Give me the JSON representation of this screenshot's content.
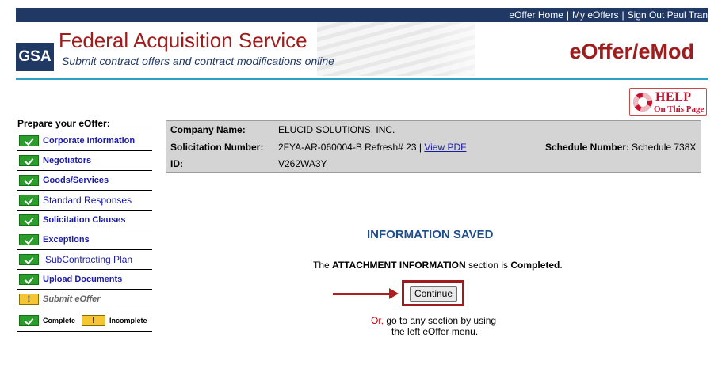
{
  "topbar": {
    "home": "eOffer Home",
    "my": "My eOffers",
    "signout": "Sign Out Paul Tran",
    "separator": "|"
  },
  "header": {
    "logo": "GSA",
    "title": "Federal Acquisition Service",
    "subtitle": "Submit contract offers and contract modifications online",
    "app_title": "eOffer/eMod"
  },
  "help": {
    "icon": "lifebuoy-icon",
    "line1": "HELP",
    "line2": "On This Page"
  },
  "sidebar": {
    "title": "Prepare your eOffer:",
    "items": [
      {
        "label": "Corporate Information",
        "status": "complete"
      },
      {
        "label": "Negotiators",
        "status": "complete"
      },
      {
        "label": "Goods/Services",
        "status": "complete"
      },
      {
        "label": "Standard Responses",
        "status": "complete"
      },
      {
        "label": "Solicitation Clauses",
        "status": "complete"
      },
      {
        "label": "Exceptions",
        "status": "complete"
      },
      {
        "label": "SubContracting Plan",
        "status": "complete"
      },
      {
        "label": "Upload Documents",
        "status": "complete"
      },
      {
        "label": "Submit eOffer",
        "status": "incomplete"
      }
    ],
    "legend": {
      "complete": "Complete",
      "incomplete": "Incomplete",
      "warn_glyph": "!"
    }
  },
  "info": {
    "company_label": "Company Name:",
    "company_value": "ELUCID SOLUTIONS, INC.",
    "solicitation_label": "Solicitation Number:",
    "solicitation_value": "2FYA-AR-060004-B Refresh# 23 |",
    "view_pdf": "View PDF",
    "schedule_label": "Schedule Number:",
    "schedule_value": "Schedule 738X",
    "id_label": "ID:",
    "id_value": "V262WA3Y"
  },
  "main": {
    "saved_title": "INFORMATION SAVED",
    "completed_pre": "The ",
    "completed_section": "ATTACHMENT INFORMATION",
    "completed_mid": " section is ",
    "completed_status": "Completed",
    "completed_end": ".",
    "continue_label": "Continue",
    "or_word": "Or,",
    "or_rest": " go to any section by using",
    "or_line2": "the left eOffer menu."
  },
  "colors": {
    "navy": "#1f3864",
    "brand_red": "#a01c1c",
    "link_blue": "#1a1aa8",
    "complete_green": "#2a9d2a",
    "incomplete_yellow": "#f6c534",
    "rule_blue": "#2f9fc4"
  }
}
